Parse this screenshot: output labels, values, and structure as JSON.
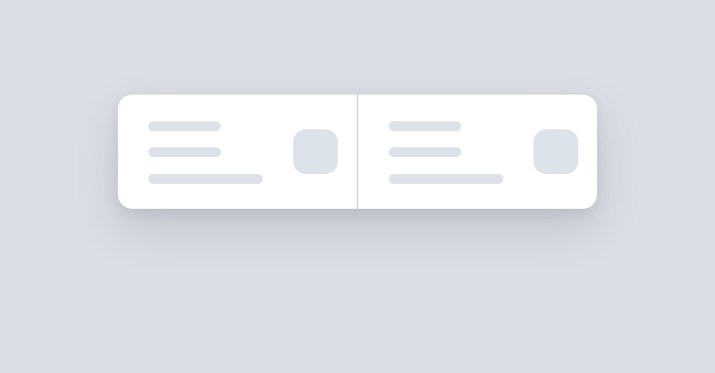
{
  "theme": {
    "background": "#dcdee5",
    "card": "#ffffff",
    "placeholder_line": "#dde1e8",
    "placeholder_thumbnail": "#dde3eb",
    "divider": "#d8dce3"
  },
  "cards": [
    {
      "state": "loading",
      "placeholder_lines": 3,
      "thumbnail": "image-placeholder-icon"
    },
    {
      "state": "loading",
      "placeholder_lines": 3,
      "thumbnail": "image-placeholder-icon"
    }
  ]
}
